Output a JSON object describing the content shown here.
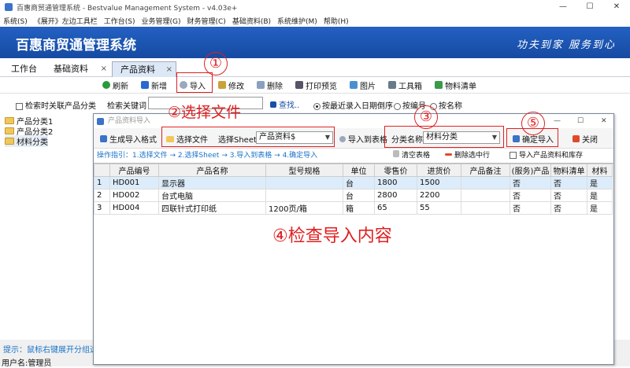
{
  "window": {
    "title": "百惠商贸通管理系统 - Bestvalue Management System - v4.03e+",
    "min": "—",
    "max": "☐",
    "close": "✕"
  },
  "menu": [
    "系统(S)",
    "《展开》左边工具栏",
    "工作台(S)",
    "业务管理(G)",
    "财务管理(C)",
    "基础资料(B)",
    "系统维护(M)",
    "帮助(H)"
  ],
  "banner": {
    "title": "百惠商贸通管理系统",
    "slogan": "功夫到家  服务到心"
  },
  "tabs": [
    {
      "label": "工作台"
    },
    {
      "label": "基础资料",
      "close": "×"
    },
    {
      "label": "产品资料",
      "close": "×"
    }
  ],
  "toolbar": [
    "刷新",
    "新增",
    "导入",
    "修改",
    "删除",
    "打印预览",
    "图片",
    "工具箱",
    "物料清单"
  ],
  "search": {
    "check_label": "检索时关联产品分类",
    "kw_label": "检索关键词",
    "find": "查找..",
    "radios": [
      "按最近录入日期倒序",
      "按编号",
      "按名称"
    ]
  },
  "tree": [
    "产品分类1",
    "产品分类2",
    "材料分类"
  ],
  "statusbar": {
    "hint": "提示：鼠标右键展开分组选项",
    "user": "用户名:管理员"
  },
  "dialog": {
    "title": "产品资料导入",
    "btn_format": "生成导入格式",
    "btn_choose": "选择文件",
    "sheet_label": "选择Sheet",
    "sheet_value": "产品资料$",
    "btn_to_table": "导入到表格",
    "cat_label": "分类名称",
    "cat_value": "材料分类",
    "btn_confirm": "确定导入",
    "btn_close": "关闭",
    "guide": "操作指引：1.选择文件 → 2.选择Sheet → 3.导入到表格 → 4.确定导入",
    "btn_clear": "清空表格",
    "btn_delrow": "删除选中行",
    "chk_stock": "导入产品资料和库存",
    "columns": [
      "",
      "产品编号",
      "产品名称",
      "型号规格",
      "单位",
      "零售价",
      "进货价",
      "产品备注",
      "(服务)产品",
      "物料清单",
      "材料"
    ],
    "rows": [
      [
        "1",
        "HD001",
        "显示器",
        "",
        "台",
        "1800",
        "1500",
        "",
        "否",
        "否",
        "是"
      ],
      [
        "2",
        "HD002",
        "台式电脑",
        "",
        "台",
        "2800",
        "2200",
        "",
        "否",
        "否",
        "是"
      ],
      [
        "3",
        "HD004",
        "四联针式打印纸",
        "1200页/箱",
        "箱",
        "65",
        "55",
        "",
        "否",
        "否",
        "是"
      ]
    ]
  },
  "annotations": {
    "c1": "①",
    "c2": "②选择文件",
    "c3": "③",
    "c4": "④检查导入内容",
    "c5": "⑤"
  },
  "colors": {
    "banner": "#1a52b0",
    "annot": "#e02020",
    "guide": "#1a73c8"
  }
}
